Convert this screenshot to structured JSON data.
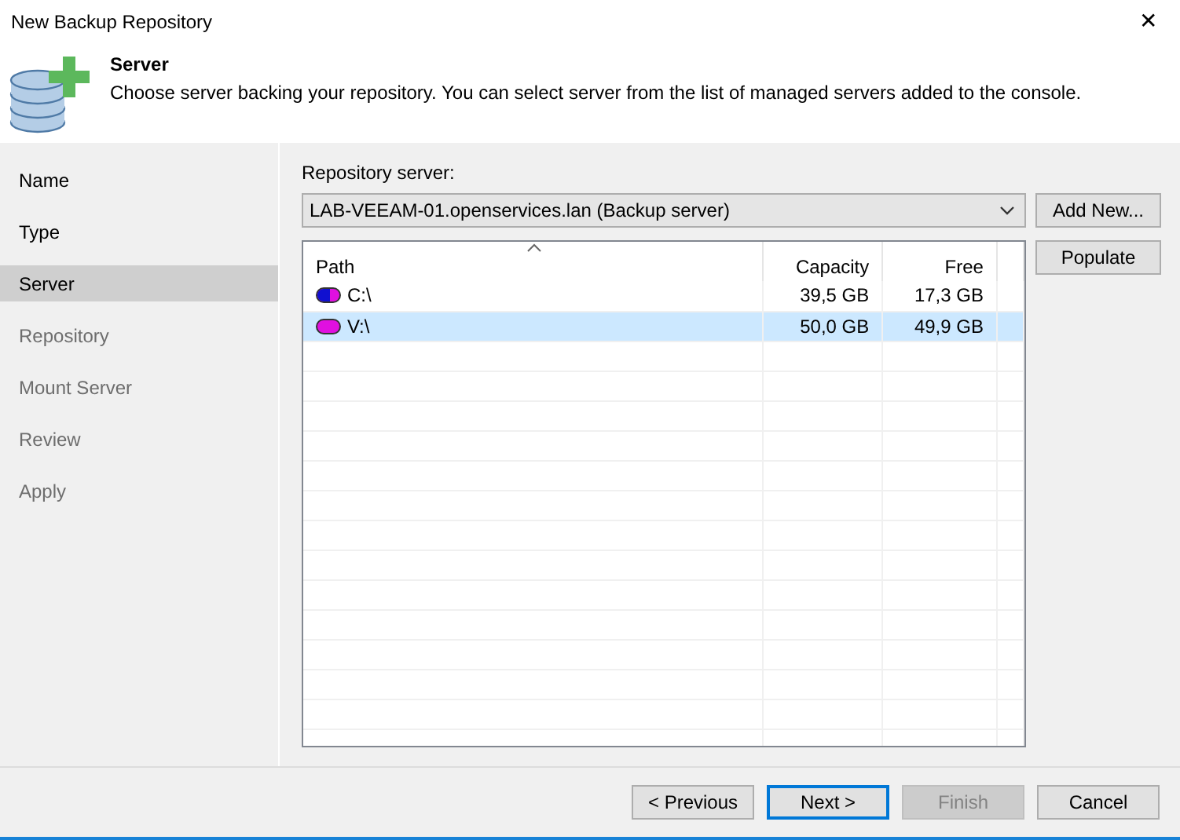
{
  "window": {
    "title": "New Backup Repository",
    "close": "✕"
  },
  "header": {
    "title": "Server",
    "description": "Choose server backing your repository. You can select server from the list of managed servers added to the console."
  },
  "steps": [
    {
      "label": "Name",
      "selected": false,
      "disabled": false
    },
    {
      "label": "Type",
      "selected": false,
      "disabled": false
    },
    {
      "label": "Server",
      "selected": true,
      "disabled": false
    },
    {
      "label": "Repository",
      "selected": false,
      "disabled": true
    },
    {
      "label": "Mount Server",
      "selected": false,
      "disabled": true
    },
    {
      "label": "Review",
      "selected": false,
      "disabled": true
    },
    {
      "label": "Apply",
      "selected": false,
      "disabled": true
    }
  ],
  "repository_server": {
    "label": "Repository server:",
    "value": "LAB-VEEAM-01.openservices.lan (Backup server)",
    "add_button": "Add New...",
    "populate_button": "Populate"
  },
  "table": {
    "columns": [
      "Path",
      "Capacity",
      "Free"
    ],
    "rows": [
      {
        "path": "C:\\",
        "capacity": "39,5 GB",
        "free": "17,3 GB",
        "level": 0.56,
        "selected": false
      },
      {
        "path": "V:\\",
        "capacity": "50,0 GB",
        "free": "49,9 GB",
        "level": 0.0,
        "selected": true
      }
    ]
  },
  "buttons": [
    {
      "label": "< Previous",
      "kind": "normal"
    },
    {
      "label": "Next >",
      "kind": "default"
    },
    {
      "label": "Finish",
      "kind": "disabled"
    },
    {
      "label": "Cancel",
      "kind": "normal"
    }
  ]
}
